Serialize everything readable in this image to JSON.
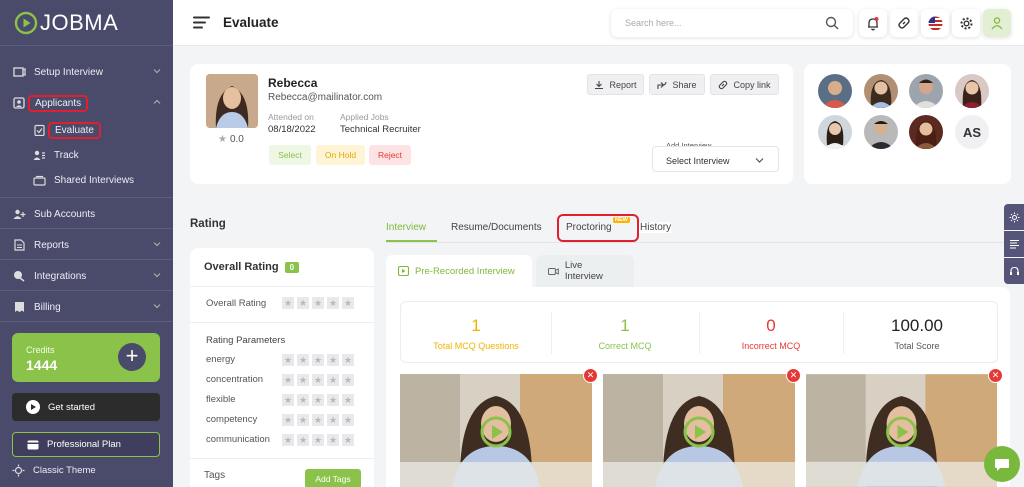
{
  "app": {
    "brand": "JOBMA",
    "accent": "#8bc34a",
    "sidebar_bg": "#4a4a6a",
    "alert": "#e0202e"
  },
  "sidebar": {
    "items": [
      {
        "label": "Setup Interview",
        "icon": "setup-interview-icon"
      },
      {
        "label": "Applicants",
        "icon": "applicants-icon"
      },
      {
        "label": "Evaluate",
        "icon": "evaluate-icon"
      },
      {
        "label": "Track",
        "icon": "track-icon"
      },
      {
        "label": "Shared Interviews",
        "icon": "shared-interviews-icon"
      },
      {
        "label": "Sub Accounts",
        "icon": "sub-accounts-icon"
      },
      {
        "label": "Reports",
        "icon": "reports-icon"
      },
      {
        "label": "Integrations",
        "icon": "integrations-icon"
      },
      {
        "label": "Billing",
        "icon": "billing-icon"
      }
    ],
    "credits_label": "Credits",
    "credits_value": "1444",
    "get_started": "Get started",
    "plan": "Professional Plan",
    "classic_theme": "Classic Theme"
  },
  "header": {
    "title": "Evaluate",
    "search_placeholder": "Search here..."
  },
  "candidate": {
    "name": "Rebecca",
    "email": "Rebecca@mailinator.com",
    "attended_label": "Attended on",
    "attended_value": "08/18/2022",
    "jobs_label": "Applied Jobs",
    "jobs_value": "Technical Recruiter",
    "rating": "0.0",
    "status_buttons": [
      "Select",
      "On Hold",
      "Reject"
    ],
    "actions": [
      "Report",
      "Share",
      "Copy link"
    ],
    "add_interview_label": "Add Interview",
    "add_interview_value": "Select Interview"
  },
  "other_applicants": {
    "initials": "AS"
  },
  "rating": {
    "section_title": "Rating",
    "overall_title": "Overall Rating",
    "overall_badge": "0",
    "overall_label": "Overall Rating",
    "params_title": "Rating Parameters",
    "params": [
      "energy",
      "concentration",
      "flexible",
      "competency",
      "communication"
    ],
    "tags_label": "Tags",
    "add_tags": "Add Tags"
  },
  "tabs": {
    "items": [
      "Interview",
      "Resume/Documents",
      "Proctoring",
      "History"
    ],
    "active": "Interview",
    "new_badge": "NEW",
    "sub": [
      "Pre-Recorded Interview",
      "Live Interview"
    ]
  },
  "stats": [
    {
      "value": "1",
      "label": "Total MCQ Questions",
      "color": "#f0b400"
    },
    {
      "value": "1",
      "label": "Correct MCQ",
      "color": "#8bc34a"
    },
    {
      "value": "0",
      "label": "Incorrect MCQ",
      "color": "#e53935"
    },
    {
      "value": "100.00",
      "label": "Total Score",
      "color": "#222222"
    }
  ]
}
